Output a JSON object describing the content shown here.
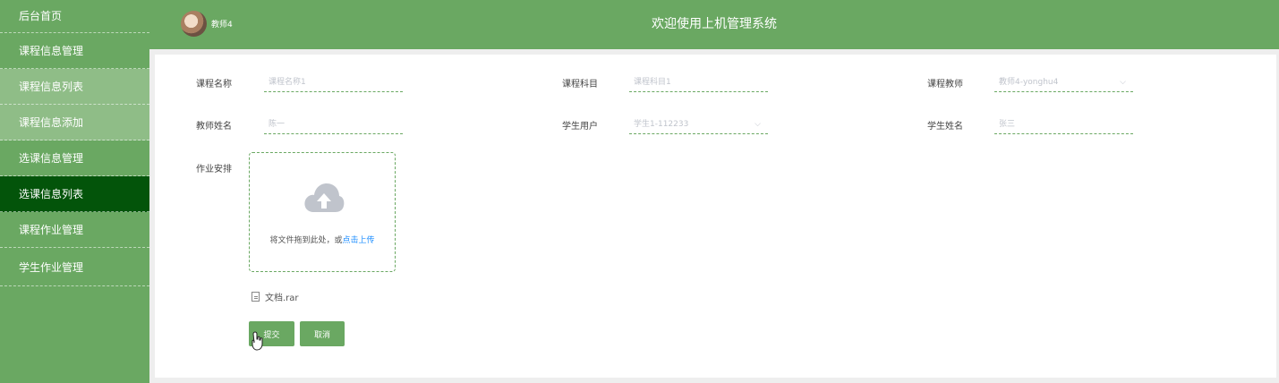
{
  "sidebar": {
    "items": [
      {
        "label": "后台首页"
      },
      {
        "label": "课程信息管理"
      },
      {
        "label": "课程信息列表"
      },
      {
        "label": "课程信息添加"
      },
      {
        "label": "选课信息管理"
      },
      {
        "label": "选课信息列表"
      },
      {
        "label": "课程作业管理"
      },
      {
        "label": "学生作业管理"
      }
    ]
  },
  "header": {
    "title": "欢迎使用上机管理系统",
    "user_name": "教师4"
  },
  "form": {
    "course_name": {
      "label": "课程名称",
      "placeholder": "课程名称1"
    },
    "course_subject": {
      "label": "课程科目",
      "placeholder": "课程科目1"
    },
    "course_teacher": {
      "label": "课程教师",
      "value": "教师4-yonghu4"
    },
    "teacher_name": {
      "label": "教师姓名",
      "placeholder": "陈一"
    },
    "student_user": {
      "label": "学生用户",
      "value": "学生1-112233"
    },
    "student_name": {
      "label": "学生姓名",
      "placeholder": "张三"
    },
    "homework": {
      "label": "作业安排",
      "upload_text": "将文件拖到此处，或",
      "upload_link": "点击上传",
      "file_name": "文档.rar"
    }
  },
  "buttons": {
    "submit": "提交",
    "cancel": "取消"
  },
  "colors": {
    "primary": "#6aa862",
    "submenu": "#8fbd87",
    "active": "#03540a",
    "link": "#1a8cff"
  }
}
